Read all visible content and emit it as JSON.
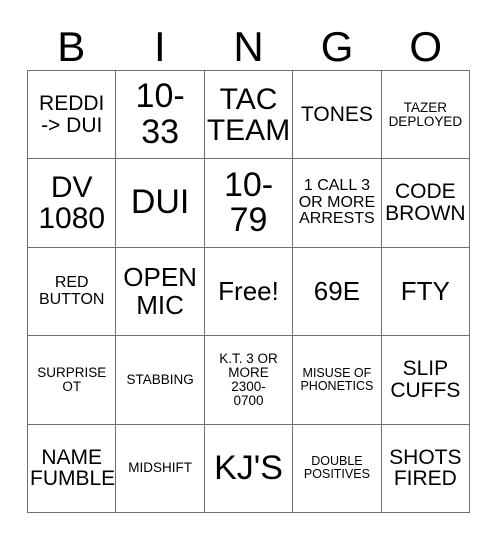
{
  "card": {
    "title": "BINGO",
    "header_letters": [
      "B",
      "I",
      "N",
      "G",
      "O"
    ],
    "free_space_label": "Free!",
    "colors": {
      "background": "#ffffff",
      "grid_line": "#6f6f6f",
      "text": "#000000"
    },
    "grid": {
      "columns": 5,
      "rows": 5,
      "cells": [
        [
          {
            "text": "REDDI\n-> DUI",
            "size": "md"
          },
          {
            "text": "10-\n33",
            "size": "xxl"
          },
          {
            "text": "TAC\nTEAM",
            "size": "xl"
          },
          {
            "text": "TONES",
            "size": "md"
          },
          {
            "text": "TAZER\nDEPLOYED",
            "size": "xs"
          }
        ],
        [
          {
            "text": "DV\n1080",
            "size": "xl"
          },
          {
            "text": "DUI",
            "size": "xxl"
          },
          {
            "text": "10-\n79",
            "size": "xxl"
          },
          {
            "text": "1 CALL 3\nOR MORE\nARRESTS",
            "size": "sm"
          },
          {
            "text": "CODE\nBROWN",
            "size": "md"
          }
        ],
        [
          {
            "text": "RED\nBUTTON",
            "size": "sm"
          },
          {
            "text": "OPEN\nMIC",
            "size": "lg"
          },
          {
            "text": "Free!",
            "size": "lg"
          },
          {
            "text": "69E",
            "size": "lg"
          },
          {
            "text": "FTY",
            "size": "lg"
          }
        ],
        [
          {
            "text": "SURPRISE\nOT",
            "size": "xs"
          },
          {
            "text": "STABBING",
            "size": "xs"
          },
          {
            "text": "K.T. 3 OR\nMORE\n2300-\n0700",
            "size": "xs"
          },
          {
            "text": "MISUSE OF\nPHONETICS",
            "size": "xxs"
          },
          {
            "text": "SLIP\nCUFFS",
            "size": "md"
          }
        ],
        [
          {
            "text": "NAME\nFUMBLE",
            "size": "md"
          },
          {
            "text": "MIDSHIFT",
            "size": "xs"
          },
          {
            "text": "KJ'S",
            "size": "xxl"
          },
          {
            "text": "DOUBLE\nPOSITIVES",
            "size": "xxs"
          },
          {
            "text": "SHOTS\nFIRED",
            "size": "md"
          }
        ]
      ]
    }
  }
}
